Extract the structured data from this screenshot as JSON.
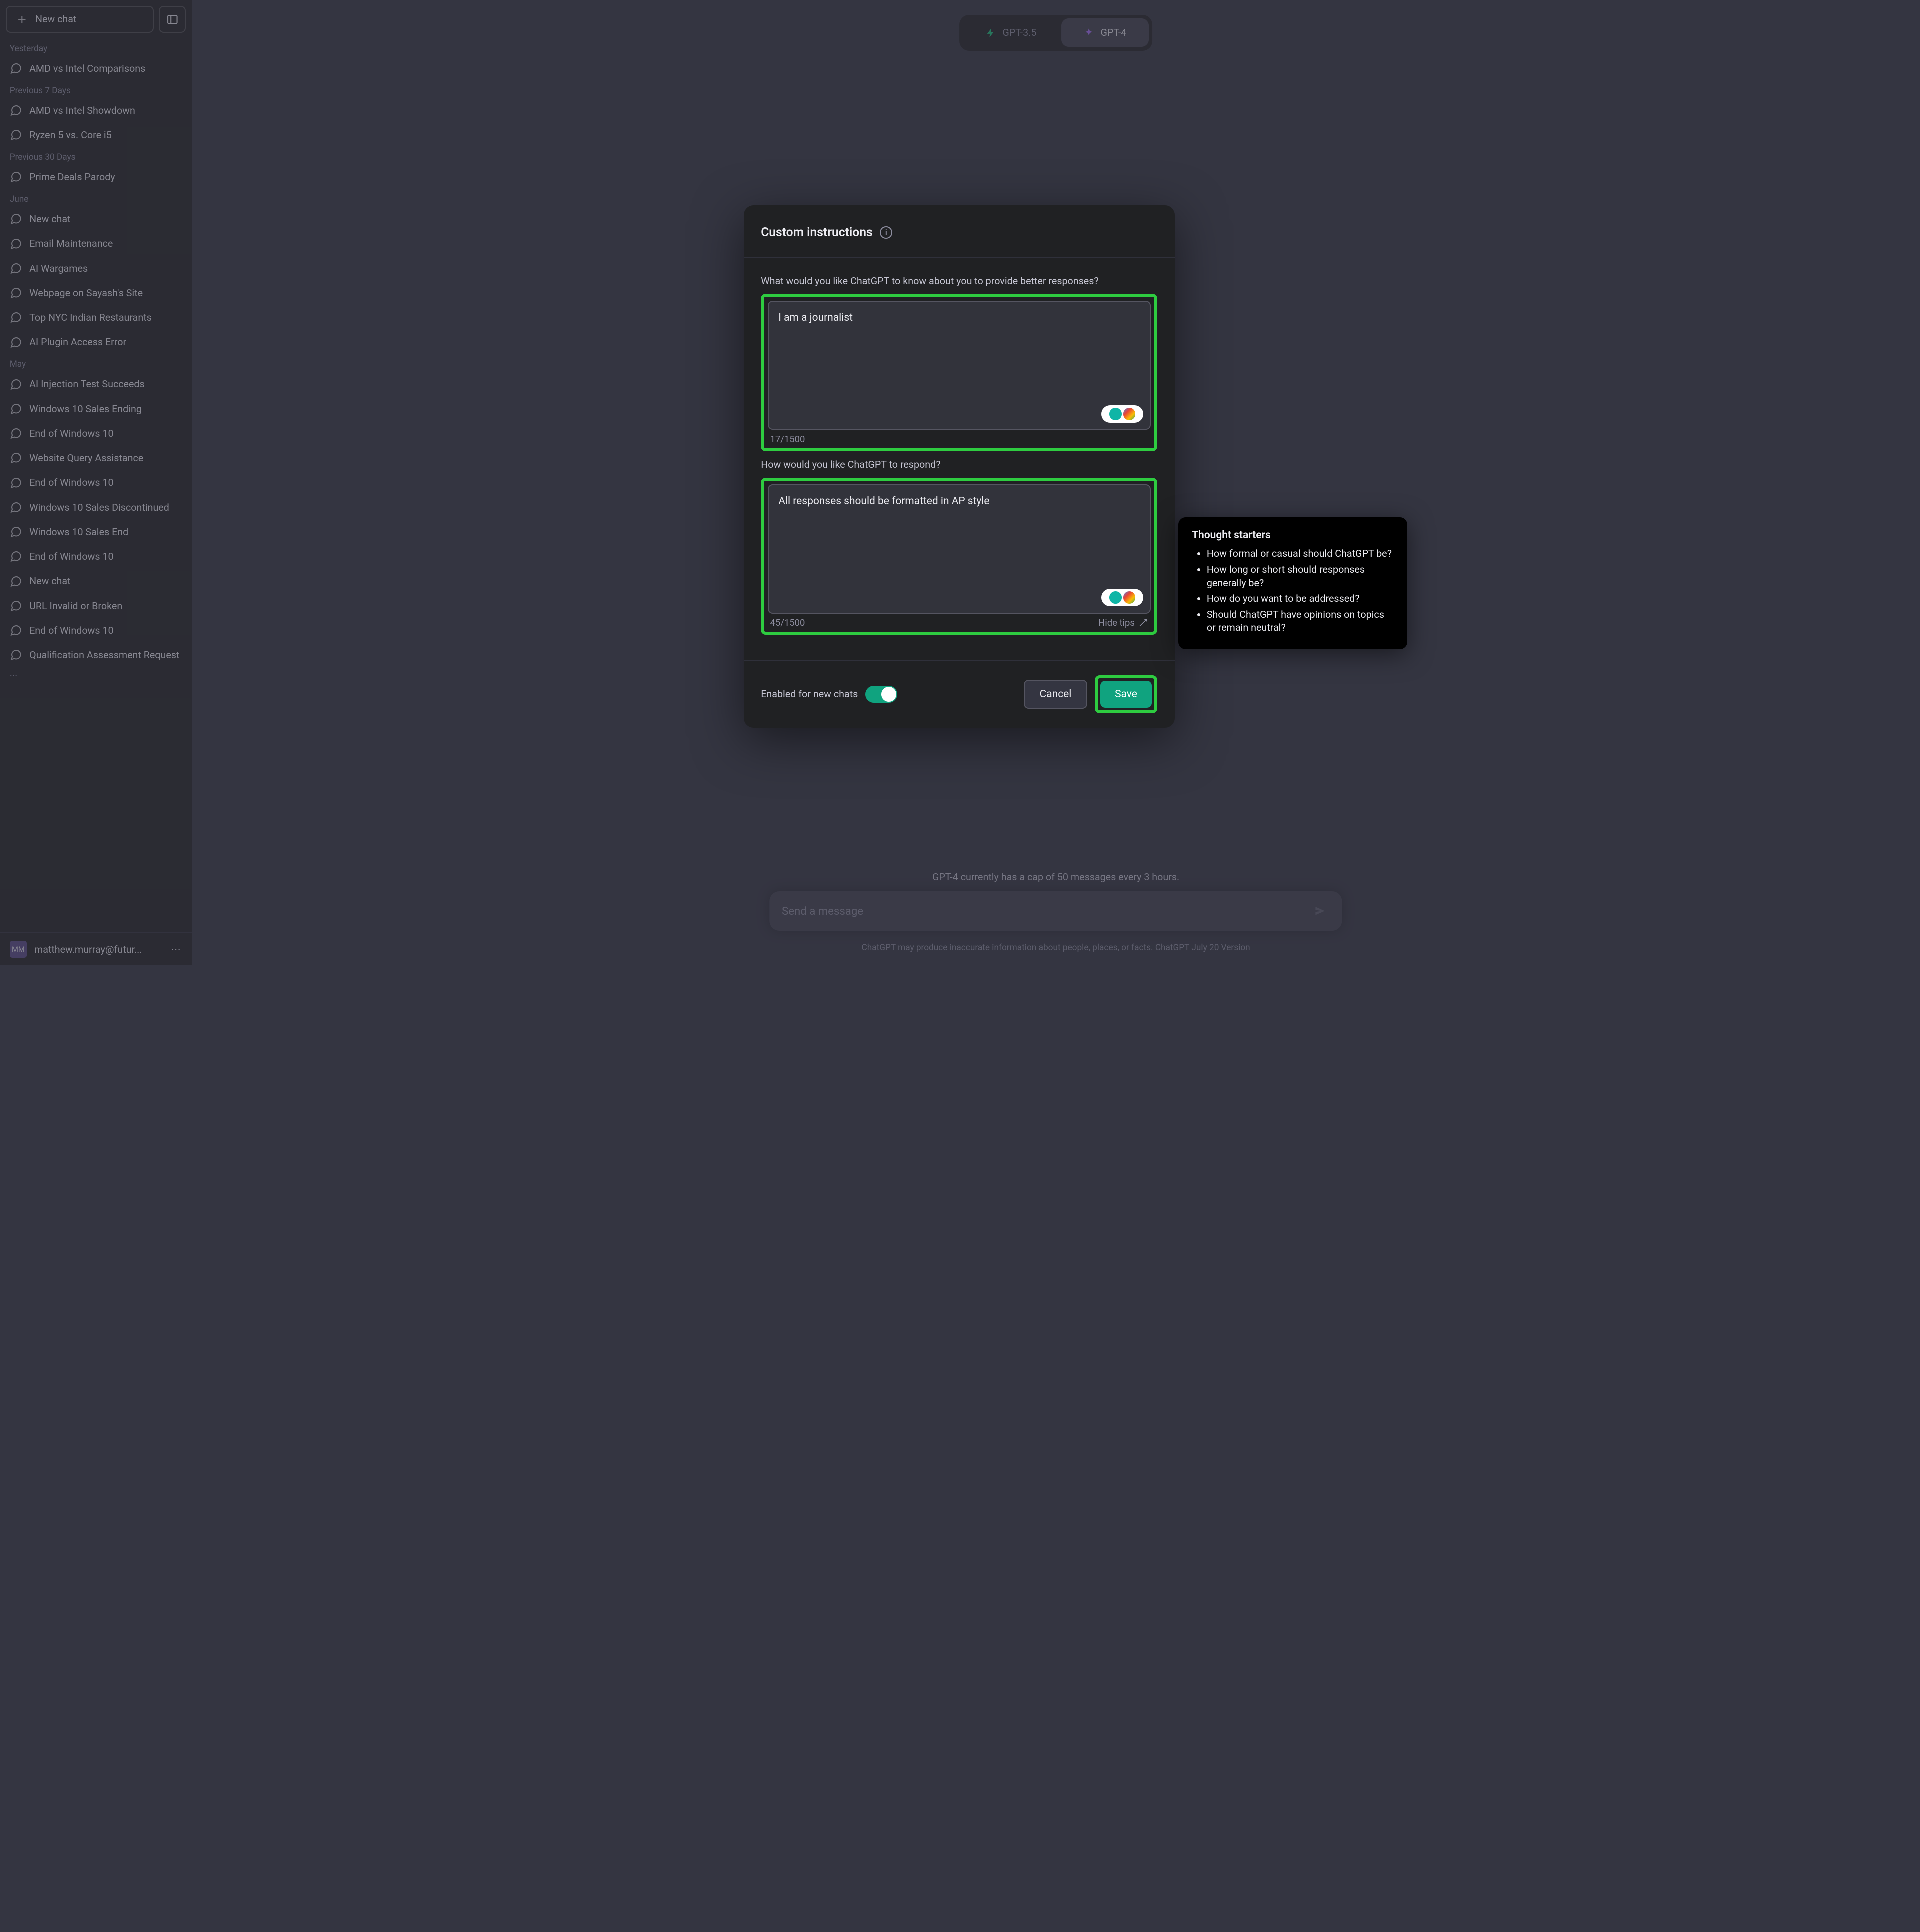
{
  "sidebar": {
    "newchat": "New chat",
    "sections": [
      {
        "title": "Yesterday",
        "items": [
          "AMD vs Intel Comparisons"
        ]
      },
      {
        "title": "Previous 7 Days",
        "items": [
          "AMD vs Intel Showdown",
          "Ryzen 5 vs. Core i5"
        ]
      },
      {
        "title": "Previous 30 Days",
        "items": [
          "Prime Deals Parody"
        ]
      },
      {
        "title": "June",
        "items": [
          "New chat",
          "Email Maintenance",
          "AI Wargames",
          "Webpage on Sayash's Site",
          "Top NYC Indian Restaurants",
          "AI Plugin Access Error"
        ]
      },
      {
        "title": "May",
        "items": [
          "AI Injection Test Succeeds",
          "Windows 10 Sales Ending",
          "End of Windows 10",
          "Website Query Assistance",
          "End of Windows 10",
          "Windows 10 Sales Discontinued",
          "Windows 10 Sales End",
          "End of Windows 10",
          "New chat",
          "URL Invalid or Broken",
          "End of Windows 10",
          "Qualification Assessment Request"
        ]
      }
    ],
    "user_initials": "MM",
    "user_email": "matthew.murray@futur..."
  },
  "models": {
    "a": "GPT-3.5",
    "b": "GPT-4"
  },
  "cap_note": "GPT-4 currently has a cap of 50 messages every 3 hours.",
  "msg_placeholder": "Send a message",
  "footer": {
    "text": "ChatGPT may produce inaccurate information about people, places, or facts. ",
    "link": "ChatGPT July 20 Version"
  },
  "modal": {
    "title": "Custom instructions",
    "q1": "What would you like ChatGPT to know about you to provide better responses?",
    "a1": "I am a journalist",
    "c1": "17/1500",
    "q2": "How would you like ChatGPT to respond?",
    "a2": "All responses should be formatted in AP style",
    "c2": "45/1500",
    "hide_tips": "Hide tips",
    "enable": "Enabled for new chats",
    "cancel": "Cancel",
    "save": "Save"
  },
  "tips": {
    "title": "Thought starters",
    "items": [
      "How formal or casual should ChatGPT be?",
      "How long or short should responses generally be?",
      "How do you want to be addressed?",
      "Should ChatGPT have opinions on topics or remain neutral?"
    ]
  }
}
